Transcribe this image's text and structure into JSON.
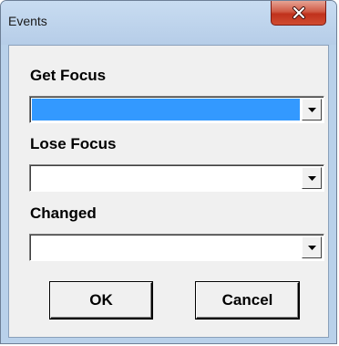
{
  "window": {
    "title": "Events"
  },
  "fields": [
    {
      "label": "Get Focus",
      "value": "",
      "highlighted": true
    },
    {
      "label": "Lose Focus",
      "value": "",
      "highlighted": false
    },
    {
      "label": "Changed",
      "value": "",
      "highlighted": false
    }
  ],
  "buttons": {
    "ok_label": "OK",
    "cancel_label": "Cancel"
  },
  "colors": {
    "selection": "#3399ff",
    "close_button": "#c0311c",
    "frame": "#b9d1ea"
  },
  "icons": {
    "close": "close-icon",
    "dropdown": "dropdown-arrow-icon"
  }
}
